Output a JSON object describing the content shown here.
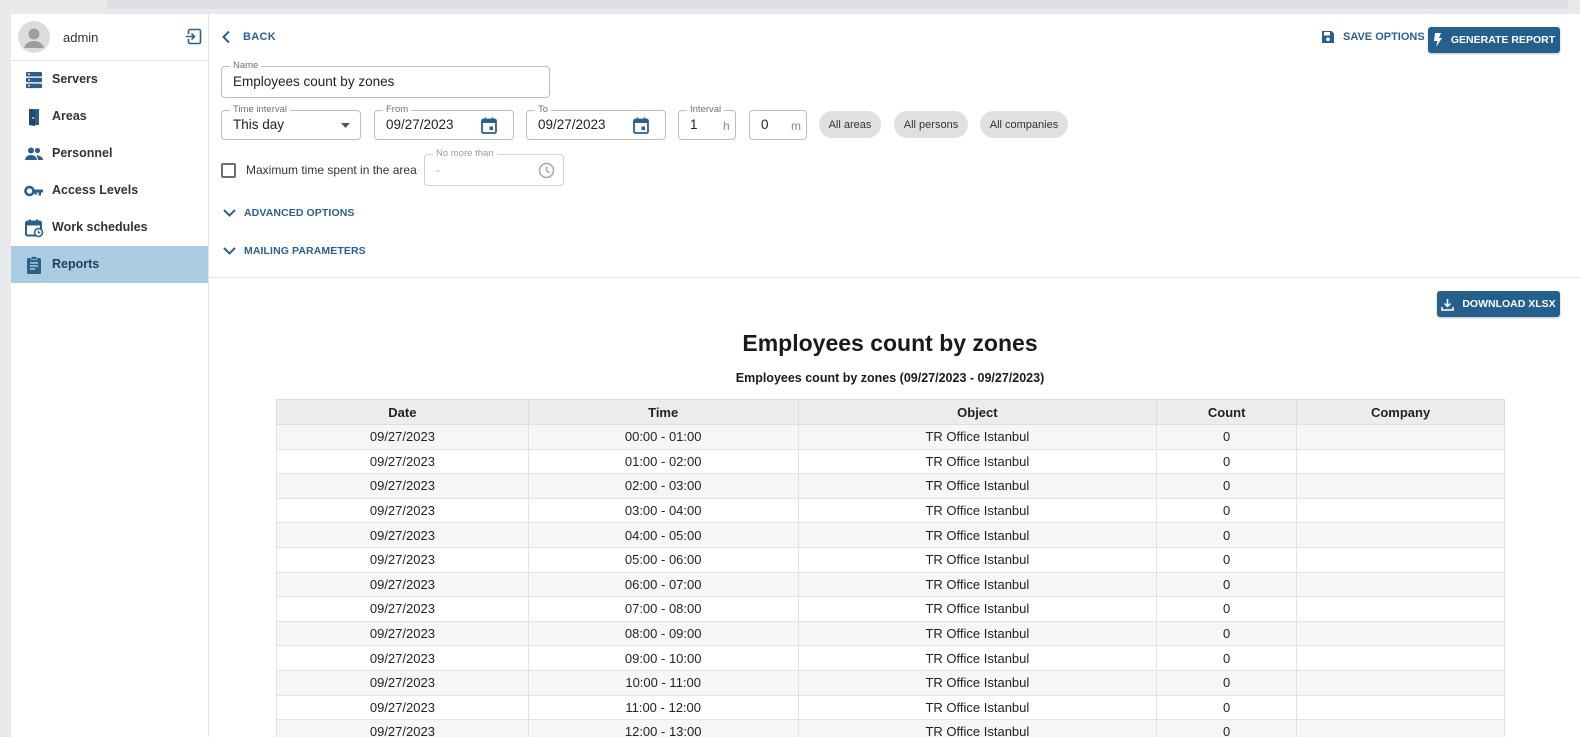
{
  "sidebar": {
    "user_name": "admin",
    "items": [
      {
        "label": "Servers",
        "icon": "servers-icon"
      },
      {
        "label": "Areas",
        "icon": "door-icon"
      },
      {
        "label": "Personnel",
        "icon": "people-icon"
      },
      {
        "label": "Access Levels",
        "icon": "key-icon"
      },
      {
        "label": "Work schedules",
        "icon": "calendar-clock-icon"
      },
      {
        "label": "Reports",
        "icon": "clipboard-icon",
        "active": true
      }
    ]
  },
  "header": {
    "back_label": "BACK",
    "save_options_label": "SAVE OPTIONS",
    "generate_label": "GENERATE REPORT"
  },
  "form": {
    "name_label": "Name",
    "name_value": "Employees count by zones",
    "time_interval_label": "Time interval",
    "time_interval_value": "This day",
    "from_label": "From",
    "from_value": "09/27/2023",
    "to_label": "To",
    "to_value": "09/27/2023",
    "interval_label": "Interval",
    "interval_hours": "1",
    "hours_unit": "h",
    "interval_minutes": "0",
    "minutes_unit": "m",
    "chips": [
      "All areas",
      "All persons",
      "All companies"
    ],
    "max_time_label": "Maximum time spent in the area",
    "no_more_than_label": "No more than",
    "no_more_than_value": "-",
    "advanced_options_label": "ADVANCED OPTIONS",
    "mailing_parameters_label": "MAILING PARAMETERS"
  },
  "report": {
    "download_label": "DOWNLOAD XLSX",
    "title": "Employees count by zones",
    "subtitle": "Employees count by zones (09/27/2023 - 09/27/2023)",
    "columns": [
      "Date",
      "Time",
      "Object",
      "Count",
      "Company"
    ],
    "rows": [
      [
        "09/27/2023",
        "00:00 - 01:00",
        "TR Office Istanbul",
        "0",
        ""
      ],
      [
        "09/27/2023",
        "01:00 - 02:00",
        "TR Office Istanbul",
        "0",
        ""
      ],
      [
        "09/27/2023",
        "02:00 - 03:00",
        "TR Office Istanbul",
        "0",
        ""
      ],
      [
        "09/27/2023",
        "03:00 - 04:00",
        "TR Office Istanbul",
        "0",
        ""
      ],
      [
        "09/27/2023",
        "04:00 - 05:00",
        "TR Office Istanbul",
        "0",
        ""
      ],
      [
        "09/27/2023",
        "05:00 - 06:00",
        "TR Office Istanbul",
        "0",
        ""
      ],
      [
        "09/27/2023",
        "06:00 - 07:00",
        "TR Office Istanbul",
        "0",
        ""
      ],
      [
        "09/27/2023",
        "07:00 - 08:00",
        "TR Office Istanbul",
        "0",
        ""
      ],
      [
        "09/27/2023",
        "08:00 - 09:00",
        "TR Office Istanbul",
        "0",
        ""
      ],
      [
        "09/27/2023",
        "09:00 - 10:00",
        "TR Office Istanbul",
        "0",
        ""
      ],
      [
        "09/27/2023",
        "10:00 - 11:00",
        "TR Office Istanbul",
        "0",
        ""
      ],
      [
        "09/27/2023",
        "11:00 - 12:00",
        "TR Office Istanbul",
        "0",
        ""
      ],
      [
        "09/27/2023",
        "12:00 - 13:00",
        "TR Office Istanbul",
        "0",
        ""
      ]
    ]
  },
  "colors": {
    "accent": "#255f8c",
    "link": "#2d5f8a",
    "active_nav": "#a9cce3"
  }
}
